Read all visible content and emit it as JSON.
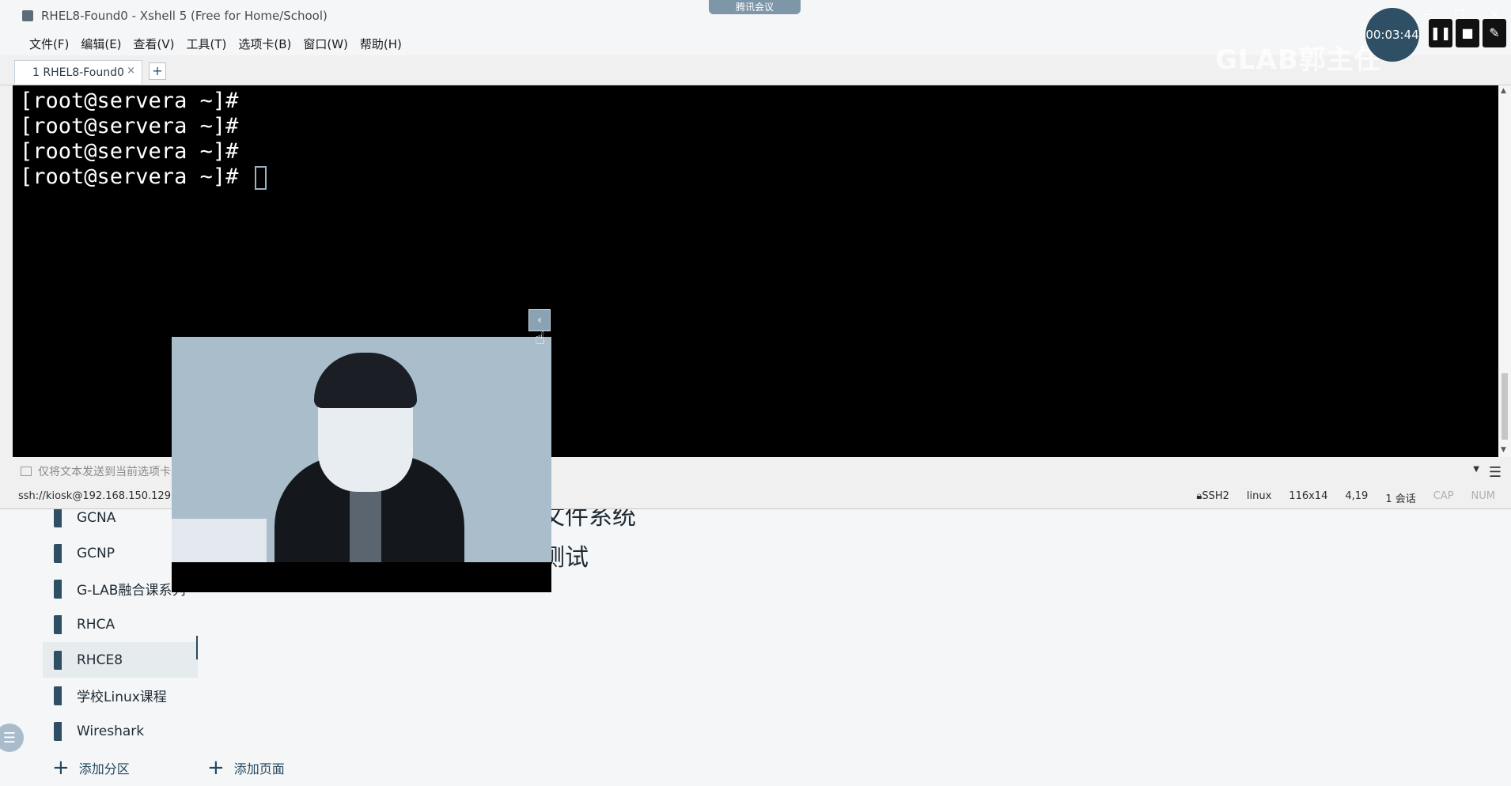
{
  "window": {
    "title": "RHEL8-Found0 - Xshell 5 (Free for Home/School)",
    "meeting_badge": "腾讯会议"
  },
  "menu": [
    "文件(F)",
    "编辑(E)",
    "查看(V)",
    "工具(T)",
    "选项卡(B)",
    "窗口(W)",
    "帮助(H)"
  ],
  "tabs": [
    {
      "label": "1 RHEL8-Found0",
      "close": "×"
    }
  ],
  "tab_add": "+",
  "terminal": {
    "lines": [
      "[root@servera ~]#",
      "[root@servera ~]#",
      "[root@servera ~]#",
      "[root@servera ~]# "
    ]
  },
  "compose_bar": {
    "placeholder": "仅将文本发送到当前选项卡"
  },
  "status_bar": {
    "connection": "ssh://kiosk@192.168.150.129:22",
    "protocol": "SSH2",
    "term": "linux",
    "size": "116x14",
    "cursor_pos": "4,19",
    "sessions": "1 会话",
    "cap": "CAP",
    "num": "NUM"
  },
  "meeting": {
    "timer": "00:03:44",
    "brand": "GLAB郭主任"
  },
  "notebook": {
    "sections": [
      {
        "label": "GCNA"
      },
      {
        "label": "GCNP"
      },
      {
        "label": "G-LAB融合课系列"
      },
      {
        "label": "RHCA"
      },
      {
        "label": "RHCE8"
      },
      {
        "label": "学校Linux课程"
      },
      {
        "label": "Wireshark"
      }
    ],
    "active_section": "RHCE8",
    "add_section": "添加分区",
    "add_page": "添加页面",
    "page_lines": [
      "文件系统",
      "测试"
    ]
  },
  "colors": {
    "terminal_bg": "#000000",
    "terminal_fg": "#ffffff",
    "accent": "#2f4f64"
  },
  "icons": [
    "xshell-app-icon",
    "tab-close-icon",
    "tab-add-icon",
    "compose-icon",
    "menu-icon",
    "lock-icon",
    "collapse-icon",
    "plus-icon",
    "nav-icon"
  ]
}
